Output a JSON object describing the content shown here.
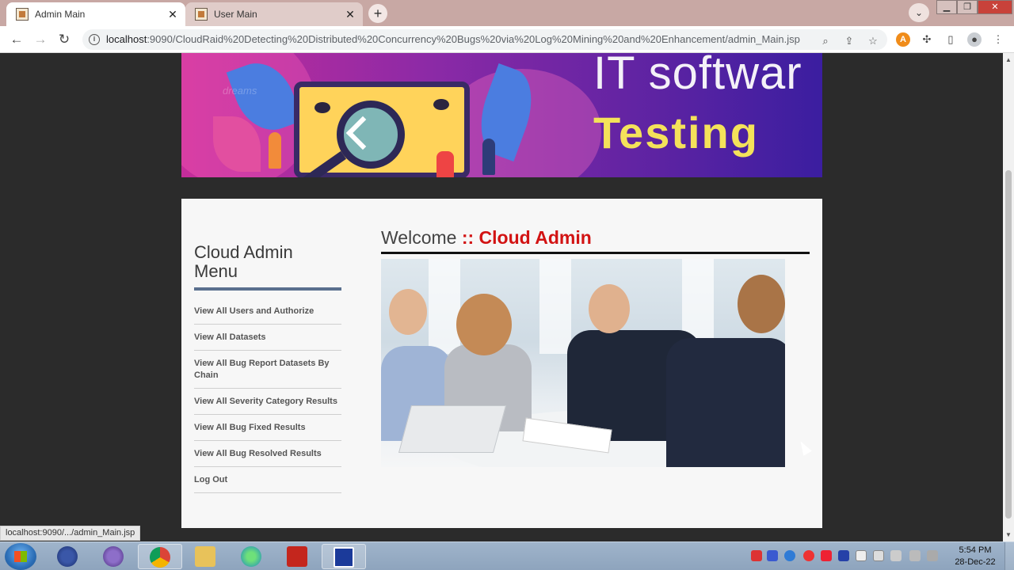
{
  "browser": {
    "tabs": [
      {
        "title": "Admin Main",
        "active": true
      },
      {
        "title": "User Main",
        "active": false
      }
    ],
    "address": {
      "host": "localhost",
      "path": ":9090/CloudRaid%20Detecting%20Distributed%20Concurrency%20Bugs%20via%20Log%20Mining%20and%20Enhancement/admin_Main.jsp"
    },
    "status_url": "localhost:9090/.../admin_Main.jsp"
  },
  "banner": {
    "line1": "IT softwar",
    "line2": "Testing",
    "watermark": "dreams"
  },
  "sidebar": {
    "title": "Cloud Admin Menu",
    "items": [
      {
        "label": "View All Users and Authorize"
      },
      {
        "label": "View All Datasets"
      },
      {
        "label": "View All Bug Report Datasets By Chain"
      },
      {
        "label": "View All Severity Category Results"
      },
      {
        "label": "View All Bug Fixed Results"
      },
      {
        "label": "View All Bug Resolved Results"
      },
      {
        "label": "Log Out"
      }
    ]
  },
  "main": {
    "welcome_prefix": "Welcome",
    "welcome_name": ":: Cloud Admin"
  },
  "taskbar": {
    "time": "5:54 PM",
    "date": "28-Dec-22"
  },
  "colors": {
    "accent_red": "#d21313",
    "menu_rule": "#5a6f8e",
    "banner_title_yellow": "#f4e25a"
  }
}
